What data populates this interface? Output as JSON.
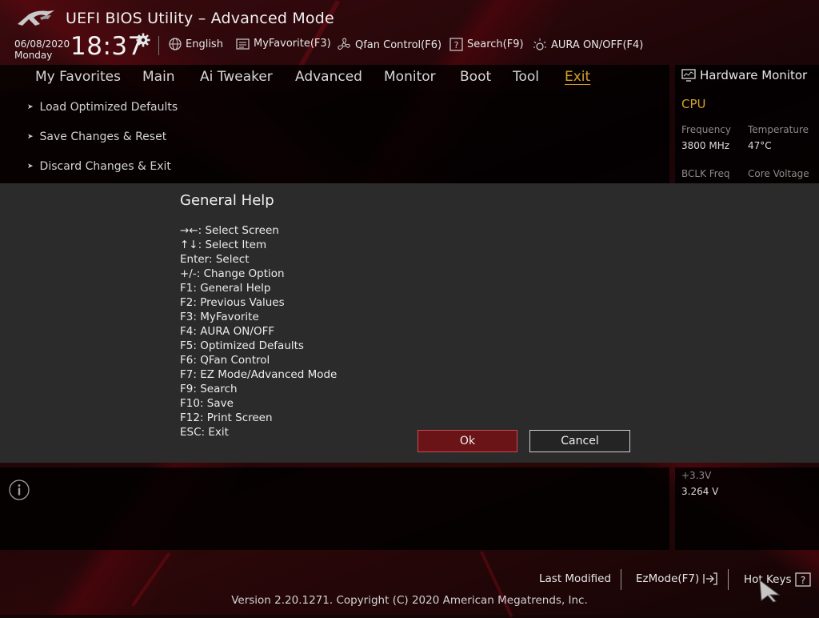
{
  "header": {
    "title": "UEFI BIOS Utility – Advanced Mode",
    "date": "06/08/2020",
    "day": "Monday",
    "time": "18:37"
  },
  "toolbar": {
    "language": "English",
    "myfavorite": "MyFavorite(F3)",
    "qfan": "Qfan Control(F6)",
    "search": "Search(F9)",
    "aura": "AURA ON/OFF(F4)"
  },
  "tabs": [
    {
      "label": "My Favorites"
    },
    {
      "label": "Main"
    },
    {
      "label": "Ai Tweaker"
    },
    {
      "label": "Advanced"
    },
    {
      "label": "Monitor"
    },
    {
      "label": "Boot"
    },
    {
      "label": "Tool"
    },
    {
      "label": "Exit"
    }
  ],
  "active_tab": "Exit",
  "exit_items": [
    {
      "label": "Load Optimized Defaults"
    },
    {
      "label": "Save Changes & Reset"
    },
    {
      "label": "Discard Changes & Exit"
    }
  ],
  "hardware_monitor": {
    "title": "Hardware Monitor",
    "cpu_label": "CPU",
    "frequency_label": "Frequency",
    "frequency_value": "3800 MHz",
    "temperature_label": "Temperature",
    "temperature_value": "47°C",
    "bclk_label": "BCLK Freq",
    "core_voltage_label": "Core Voltage",
    "v33_label": "+3.3V",
    "v33_value": "3.264 V"
  },
  "dialog": {
    "title": "General Help",
    "lines": [
      "→←: Select Screen",
      "↑↓: Select Item",
      "Enter: Select",
      "+/-: Change Option",
      "F1: General Help",
      "F2: Previous Values",
      "F3: MyFavorite",
      "F4: AURA ON/OFF",
      "F5: Optimized Defaults",
      "F6: QFan Control",
      "F7: EZ Mode/Advanced Mode",
      "F9: Search",
      "F10: Save",
      "F12: Print Screen",
      "ESC: Exit"
    ],
    "ok_label": "Ok",
    "cancel_label": "Cancel"
  },
  "footer": {
    "last_modified": "Last Modified",
    "ezmode": "EzMode(F7)",
    "hotkeys": "Hot Keys",
    "version": "Version 2.20.1271. Copyright (C) 2020 American Megatrends, Inc."
  },
  "colors": {
    "accent": "#d4a22a",
    "ok_button": "#6b1418",
    "dialog_bg": "#2b2b2b"
  }
}
